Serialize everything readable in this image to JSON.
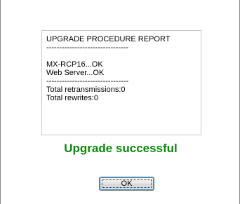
{
  "report": {
    "title": "UPGRADE PROCEDURE REPORT",
    "separator_top": "--------------------------------",
    "items": [
      "MX-RCP16...OK",
      "Web Server...OK"
    ],
    "separator_bottom": "--------------------------------",
    "totals": [
      "Total retransmissions:0",
      "Total rewrites:0"
    ]
  },
  "status": {
    "message": "Upgrade successful",
    "color": "#0a8a0a"
  },
  "buttons": {
    "ok_label": "OK"
  }
}
